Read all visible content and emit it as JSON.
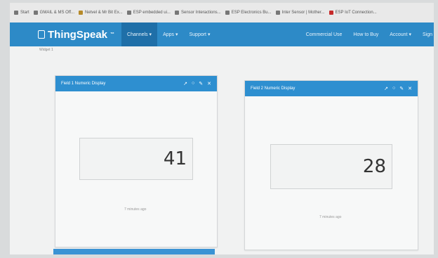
{
  "bookmarks": [
    {
      "label": "Start"
    },
    {
      "label": "GMAIL & MS Off..."
    },
    {
      "label": "Netvel & Mr Bit Ex..."
    },
    {
      "label": "ESP embedded ui..."
    },
    {
      "label": "Sensor Interactions..."
    },
    {
      "label": "ESP Electronics Bu..."
    },
    {
      "label": "Inter Sensor | Mother..."
    },
    {
      "label": "ESP IoT Connection..."
    }
  ],
  "nav": {
    "brand": "ThingSpeak",
    "brand_tm": "™",
    "channels": "Channels ▾",
    "apps": "Apps ▾",
    "support": "Support ▾",
    "commercial": "Commercial Use",
    "how_to_buy": "How to Buy",
    "account": "Account ▾",
    "sign": "Sign"
  },
  "subheading": "Widget 1",
  "widgets": [
    {
      "title": "Field 1 Numeric Display",
      "value": "41",
      "footnote": "7 minutes ago"
    },
    {
      "title": "Field 2 Numeric Display",
      "value": "28",
      "footnote": "7 minutes ago"
    }
  ],
  "colors": {
    "nav": "#2d8ac7",
    "widget_header": "#2e8fd0"
  }
}
